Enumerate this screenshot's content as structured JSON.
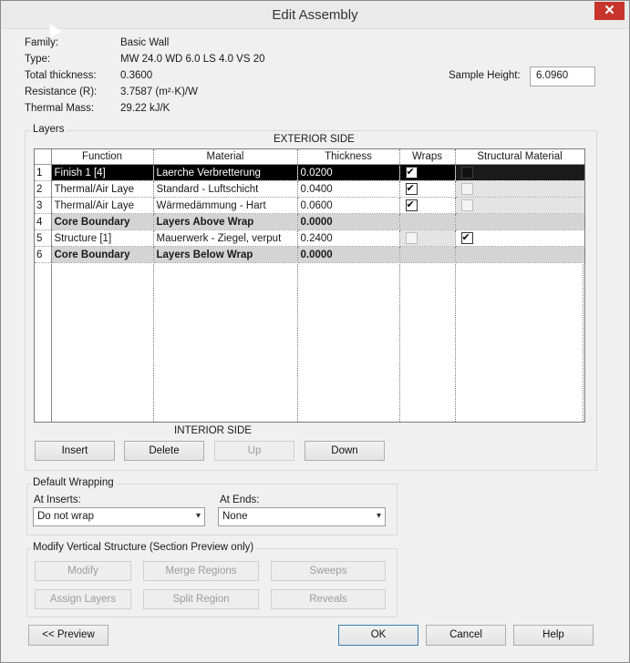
{
  "window": {
    "title": "Edit Assembly",
    "close_glyph": "✕"
  },
  "properties": [
    {
      "label": "Family:",
      "value": "Basic Wall"
    },
    {
      "label": "Type:",
      "value": "MW 24.0 WD 6.0 LS 4.0 VS 20"
    },
    {
      "label": "Total thickness:",
      "value": "0.3600"
    },
    {
      "label": "Resistance (R):",
      "value": "3.7587 (m²·K)/W"
    },
    {
      "label": "Thermal Mass:",
      "value": "29.22 kJ/K"
    }
  ],
  "sample_height": {
    "label": "Sample Height:",
    "value": "6.0960"
  },
  "layers": {
    "group_title": "Layers",
    "exterior_label": "EXTERIOR SIDE",
    "interior_label": "INTERIOR SIDE",
    "columns": [
      "",
      "Function",
      "Material",
      "Thickness",
      "Wraps",
      "Structural Material"
    ],
    "rows": [
      {
        "num": "1",
        "function": "Finish 1 [4]",
        "material": "Laerche Verbretterung",
        "thickness": "0.0200",
        "wraps": "checked",
        "structural": "disabled-dark"
      },
      {
        "num": "2",
        "function": "Thermal/Air Laye",
        "material": "Standard - Luftschicht",
        "thickness": "0.0400",
        "wraps": "checked",
        "structural": "disabled"
      },
      {
        "num": "3",
        "function": "Thermal/Air Laye",
        "material": "Wärmedämmung - Hart",
        "thickness": "0.0600",
        "wraps": "checked",
        "structural": "disabled"
      },
      {
        "num": "4",
        "function": "Core Boundary",
        "material": "Layers Above Wrap",
        "thickness": "0.0000",
        "wraps": "none",
        "structural": "none"
      },
      {
        "num": "5",
        "function": "Structure [1]",
        "material": "Mauerwerk - Ziegel, verput",
        "thickness": "0.2400",
        "wraps": "disabled",
        "structural": "checked"
      },
      {
        "num": "6",
        "function": "Core Boundary",
        "material": "Layers Below Wrap",
        "thickness": "0.0000",
        "wraps": "none",
        "structural": "none"
      }
    ],
    "buttons": {
      "insert": "Insert",
      "delete": "Delete",
      "up": "Up",
      "down": "Down"
    }
  },
  "default_wrapping": {
    "title": "Default Wrapping",
    "at_inserts_label": "At Inserts:",
    "at_inserts_value": "Do not wrap",
    "at_ends_label": "At Ends:",
    "at_ends_value": "None"
  },
  "modify_vertical": {
    "title": "Modify Vertical Structure (Section Preview only)",
    "buttons": {
      "modify": "Modify",
      "merge": "Merge Regions",
      "sweeps": "Sweeps",
      "assign": "Assign Layers",
      "split": "Split Region",
      "reveals": "Reveals"
    }
  },
  "footer": {
    "preview": "<< Preview",
    "ok": "OK",
    "cancel": "Cancel",
    "help": "Help"
  },
  "icons": {
    "dropdown": "▾"
  }
}
